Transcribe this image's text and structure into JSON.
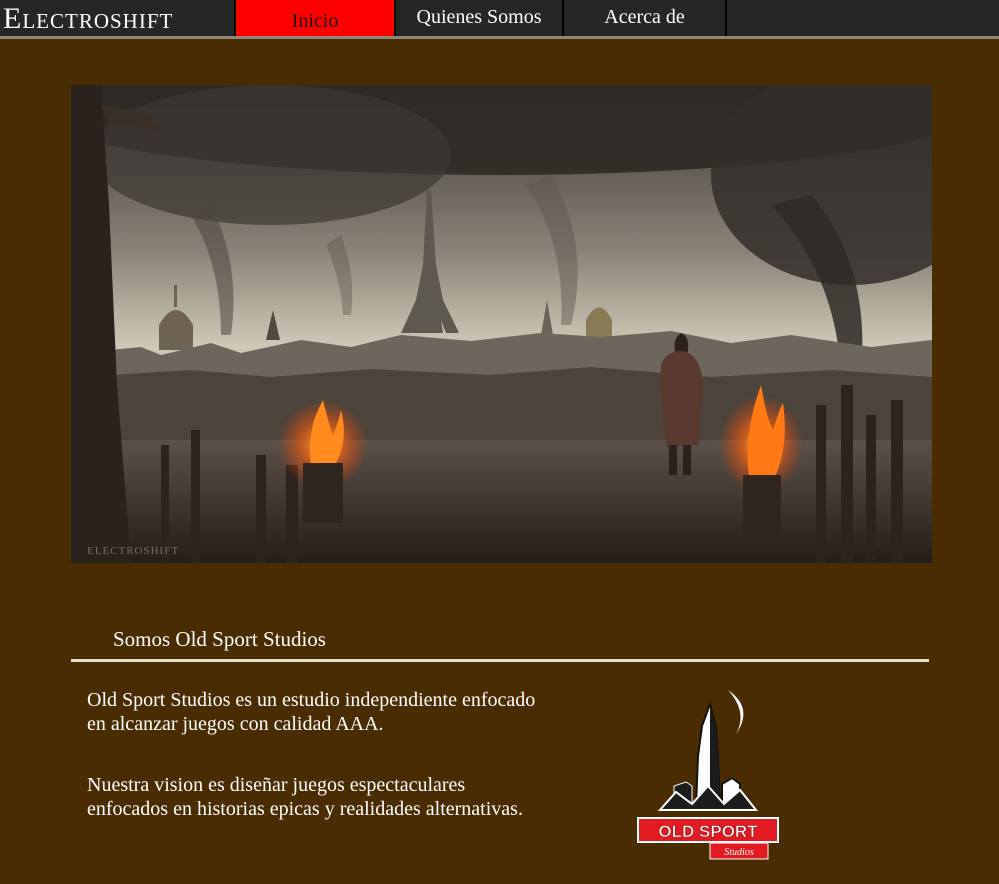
{
  "brand": {
    "name": "Electroshift"
  },
  "nav": {
    "tabs": [
      {
        "label": "Inicio",
        "active": true
      },
      {
        "label": "Quienes Somos",
        "active": false
      },
      {
        "label": "Acerca de",
        "active": false
      }
    ]
  },
  "hero": {
    "watermark": "ELECTROSHIFT"
  },
  "about": {
    "title": "Somos Old Sport Studios",
    "paragraphs": [
      "Old Sport Studios es un estudio independiente enfocado en alcanzar juegos con calidad AAA.",
      "Nuestra vision es diseñar juegos espectaculares enfocados en historias epicas y realidades alternativas."
    ]
  },
  "logo": {
    "line1": "OLD SPORT",
    "line2": "Studios"
  },
  "colors": {
    "page_background": "#4a2c03",
    "nav_background": "#262626",
    "nav_active": "#ff0000",
    "logo_red": "#e21b22"
  }
}
